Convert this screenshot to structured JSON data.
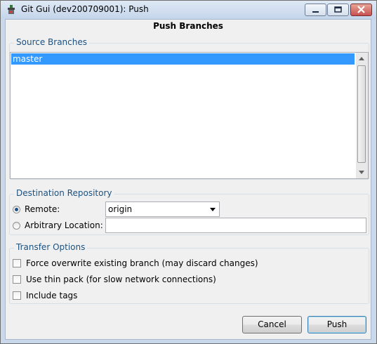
{
  "window": {
    "title": "Git Gui (dev200709001): Push"
  },
  "heading": "Push Branches",
  "source": {
    "group_label": "Source Branches",
    "branches": [
      "master"
    ]
  },
  "destination": {
    "group_label": "Destination Repository",
    "remote_label": "Remote:",
    "remote_value": "origin",
    "remote_selected": true,
    "arbitrary_label": "Arbitrary Location:",
    "arbitrary_value": ""
  },
  "transfer": {
    "group_label": "Transfer Options",
    "force_label": "Force overwrite existing branch (may discard changes)",
    "thin_label": "Use thin pack (for slow network connections)",
    "tags_label": "Include tags"
  },
  "buttons": {
    "cancel": "Cancel",
    "push": "Push"
  },
  "colors": {
    "selection": "#3399ff",
    "group_label": "#1c5180",
    "close_button": "#c75050"
  },
  "icons": [
    "git-gui-icon",
    "minimize-icon",
    "maximize-icon",
    "close-icon",
    "scroll-up-arrow-icon",
    "scroll-down-arrow-icon",
    "dropdown-arrow-icon"
  ]
}
